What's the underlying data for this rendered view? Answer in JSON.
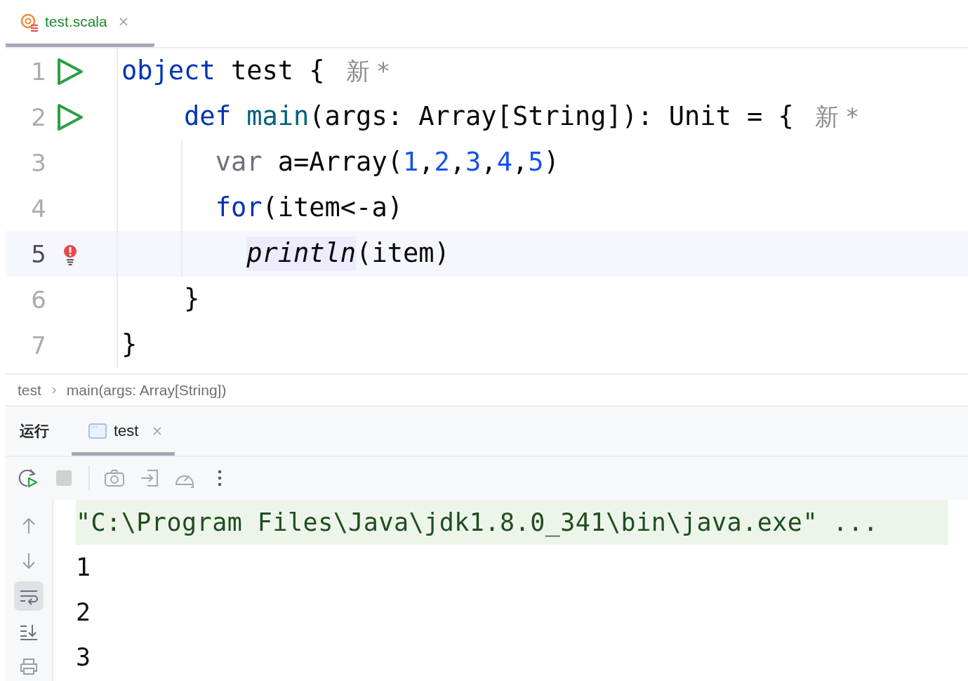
{
  "editor_tabs": [
    {
      "label": "test.scala",
      "selected": true
    }
  ],
  "code": {
    "lines": [
      {
        "number": "1",
        "kind": "runnable",
        "current": false,
        "tokens": [
          {
            "kind": "keyword",
            "text": "object"
          },
          {
            "kind": "plain",
            "text": " test {"
          },
          {
            "kind": "hint",
            "text": "新 *"
          }
        ],
        "children": [
          {
            "number": "2",
            "kind": "runnable",
            "current": false,
            "tokens": [
              {
                "kind": "keyword",
                "text": "def"
              },
              {
                "kind": "function",
                "text": "main"
              },
              {
                "kind": "plain",
                "text": "(args: Array[String]): Unit = {"
              },
              {
                "kind": "hint",
                "text": "新 *"
              }
            ],
            "children": [
              {
                "number": "3",
                "current": false,
                "tokens": [
                  {
                    "kind": "modifier",
                    "text": "var"
                  },
                  {
                    "kind": "plain",
                    "text": " a=Array("
                  },
                  {
                    "kind": "number",
                    "text": "1"
                  },
                  {
                    "kind": "plain",
                    "text": ","
                  },
                  {
                    "kind": "number",
                    "text": "2"
                  },
                  {
                    "kind": "plain",
                    "text": ","
                  },
                  {
                    "kind": "number",
                    "text": "3"
                  },
                  {
                    "kind": "plain",
                    "text": ","
                  },
                  {
                    "kind": "number",
                    "text": "4"
                  },
                  {
                    "kind": "plain",
                    "text": ","
                  },
                  {
                    "kind": "number",
                    "text": "5"
                  },
                  {
                    "kind": "plain",
                    "text": ")"
                  }
                ]
              },
              {
                "number": "4",
                "current": false,
                "tokens": [
                  {
                    "kind": "keyword",
                    "text": "for"
                  },
                  {
                    "kind": "plain",
                    "text": "(item<-a)"
                  }
                ],
                "children": [
                  {
                    "number": "5",
                    "kind": "warning",
                    "current": true,
                    "tokens": [
                      {
                        "kind": "usage",
                        "text": "println"
                      },
                      {
                        "kind": "plain",
                        "text": "(item)"
                      }
                    ]
                  }
                ]
              }
            ]
          },
          {
            "number": "6",
            "current": false,
            "tokens": [
              {
                "kind": "plain",
                "text": "}"
              }
            ]
          }
        ]
      },
      {
        "number": "7",
        "current": false,
        "tokens": [
          {
            "kind": "plain",
            "text": "}"
          }
        ]
      }
    ]
  },
  "breadcrumbs": [
    "test",
    "main(args: Array[String])"
  ],
  "run_panel": {
    "title": "运行",
    "tabs": [
      {
        "label": "test",
        "selected": true
      }
    ],
    "toolbar": [
      {
        "kind": "rerun",
        "disabled": false
      },
      {
        "kind": "stop",
        "disabled": true
      },
      {
        "kind": "separator"
      },
      {
        "kind": "camera",
        "disabled": true
      },
      {
        "kind": "import",
        "disabled": true
      },
      {
        "kind": "gauge",
        "disabled": true
      },
      {
        "kind": "more",
        "disabled": false
      }
    ],
    "side_tools": [
      {
        "kind": "up",
        "selected": false
      },
      {
        "kind": "down",
        "selected": false
      },
      {
        "kind": "wrap",
        "selected": true
      },
      {
        "kind": "scroll-end",
        "selected": false
      },
      {
        "kind": "print",
        "selected": false
      }
    ],
    "console": [
      {
        "kind": "command",
        "text": "\"C:\\Program Files\\Java\\jdk1.8.0_341\\bin\\java.exe\" ..."
      },
      {
        "kind": "output",
        "text": "1"
      },
      {
        "kind": "output",
        "text": "2"
      },
      {
        "kind": "output",
        "text": "3"
      }
    ]
  }
}
